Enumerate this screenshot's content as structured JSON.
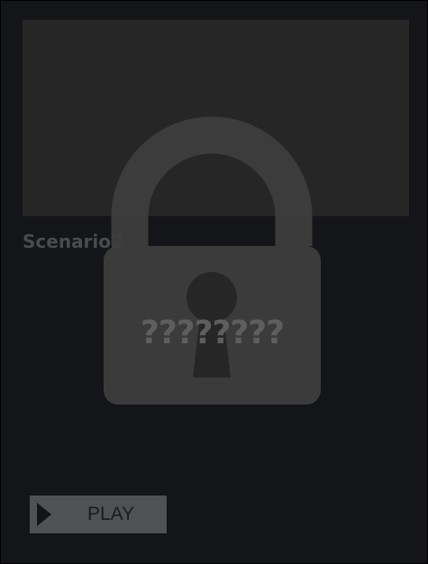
{
  "card": {
    "title": "Scenario2",
    "locked": true,
    "lock_text": "????????",
    "play_label": "PLAY"
  },
  "icons": {
    "lock": "lock-icon",
    "keyhole": "keyhole-icon",
    "play": "play-icon"
  },
  "colors": {
    "page_background": "#000000",
    "card_background": "#141518",
    "thumbnail_background": "#262626",
    "lock_fill": "#3d3d3d",
    "button_background": "#505152"
  }
}
